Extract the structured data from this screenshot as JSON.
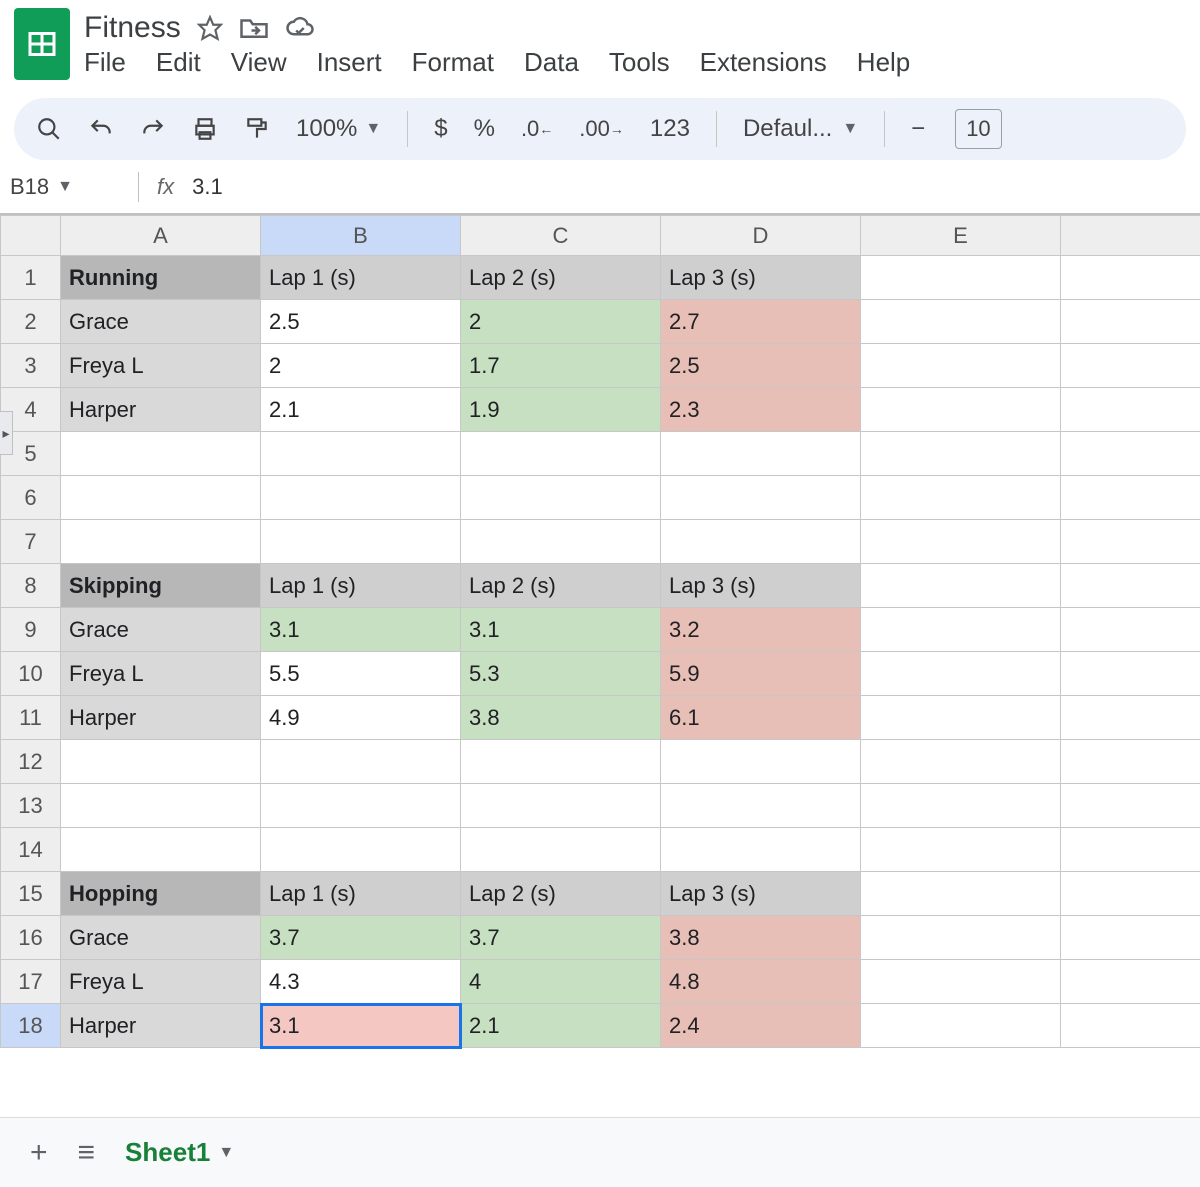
{
  "doc": {
    "title": "Fitness"
  },
  "menus": [
    "File",
    "Edit",
    "View",
    "Insert",
    "Format",
    "Data",
    "Tools",
    "Extensions",
    "Help"
  ],
  "toolbar": {
    "zoom": "100%",
    "font_name": "Defaul...",
    "font_size": "10"
  },
  "formula": {
    "cell_ref": "B18",
    "fx_label": "fx",
    "value": "3.1"
  },
  "columns": [
    "A",
    "B",
    "C",
    "D",
    "E",
    ""
  ],
  "row_count": 18,
  "cells": {
    "r1": {
      "A": "Running",
      "B": "Lap 1 (s)",
      "C": "Lap 2  (s)",
      "D": "Lap 3  (s)"
    },
    "r2": {
      "A": "Grace",
      "B": "2.5",
      "C": "2",
      "D": "2.7"
    },
    "r3": {
      "A": "Freya L",
      "B": "2",
      "C": "1.7",
      "D": "2.5"
    },
    "r4": {
      "A": "Harper",
      "B": "2.1",
      "C": "1.9",
      "D": "2.3"
    },
    "r8": {
      "A": "Skipping",
      "B": "Lap 1 (s)",
      "C": "Lap 2  (s)",
      "D": "Lap 3  (s)"
    },
    "r9": {
      "A": "Grace",
      "B": "3.1",
      "C": "3.1",
      "D": "3.2"
    },
    "r10": {
      "A": "Freya L",
      "B": "5.5",
      "C": "5.3",
      "D": "5.9"
    },
    "r11": {
      "A": "Harper",
      "B": "4.9",
      "C": "3.8",
      "D": "6.1"
    },
    "r15": {
      "A": "Hopping",
      "B": "Lap 1 (s)",
      "C": "Lap 2  (s)",
      "D": "Lap 3  (s)"
    },
    "r16": {
      "A": "Grace",
      "B": "3.7",
      "C": "3.7",
      "D": "3.8"
    },
    "r17": {
      "A": "Freya L",
      "B": "4.3",
      "C": "4",
      "D": "4.8"
    },
    "r18": {
      "A": "Harper",
      "B": "3.1",
      "C": "2.1",
      "D": "2.4"
    }
  },
  "sheet_tab": {
    "name": "Sheet1"
  },
  "chart_data": [
    {
      "type": "table",
      "title": "Running",
      "columns": [
        "Lap 1 (s)",
        "Lap 2  (s)",
        "Lap 3  (s)"
      ],
      "rows": [
        {
          "name": "Grace",
          "values": [
            2.5,
            2,
            2.7
          ]
        },
        {
          "name": "Freya L",
          "values": [
            2,
            1.7,
            2.5
          ]
        },
        {
          "name": "Harper",
          "values": [
            2.1,
            1.9,
            2.3
          ]
        }
      ]
    },
    {
      "type": "table",
      "title": "Skipping",
      "columns": [
        "Lap 1 (s)",
        "Lap 2  (s)",
        "Lap 3  (s)"
      ],
      "rows": [
        {
          "name": "Grace",
          "values": [
            3.1,
            3.1,
            3.2
          ]
        },
        {
          "name": "Freya L",
          "values": [
            5.5,
            5.3,
            5.9
          ]
        },
        {
          "name": "Harper",
          "values": [
            4.9,
            3.8,
            6.1
          ]
        }
      ]
    },
    {
      "type": "table",
      "title": "Hopping",
      "columns": [
        "Lap 1 (s)",
        "Lap 2  (s)",
        "Lap 3  (s)"
      ],
      "rows": [
        {
          "name": "Grace",
          "values": [
            3.7,
            3.7,
            3.8
          ]
        },
        {
          "name": "Freya L",
          "values": [
            4.3,
            4,
            4.8
          ]
        },
        {
          "name": "Harper",
          "values": [
            3.1,
            2.1,
            2.4
          ]
        }
      ]
    }
  ]
}
